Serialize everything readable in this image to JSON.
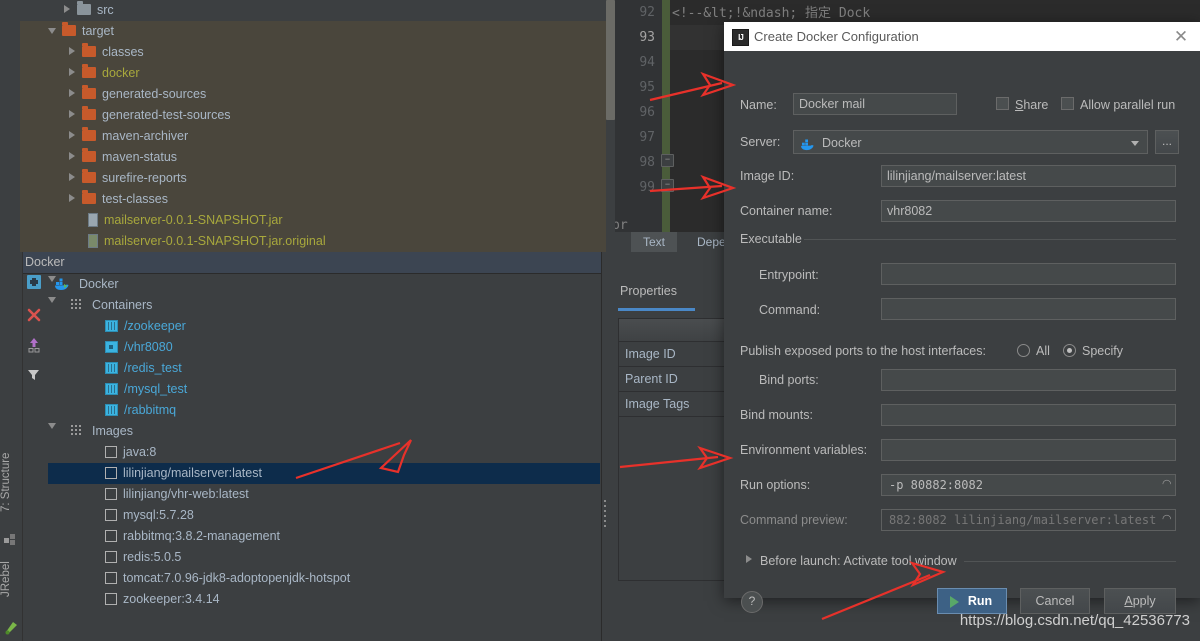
{
  "editor": {
    "code_line": "<!--&lt;!&ndash; 指定 Dock",
    "line_numbers": [
      "92",
      "93",
      "94",
      "95",
      "96",
      "97",
      "98",
      "99"
    ],
    "current_line": "93",
    "pre_text": "pr",
    "tabs": [
      {
        "label": "Text",
        "selected": true
      },
      {
        "label": "Depen",
        "selected": false
      }
    ]
  },
  "project_tree": [
    {
      "label": "src",
      "indent": 43,
      "arrow": "right",
      "icon": "folder-grey",
      "color": "normal"
    },
    {
      "label": "target",
      "indent": 28,
      "arrow": "down",
      "icon": "folder-orange",
      "color": "normal"
    },
    {
      "label": "classes",
      "indent": 48,
      "arrow": "right",
      "icon": "folder-orange",
      "color": "normal"
    },
    {
      "label": "docker",
      "indent": 48,
      "arrow": "right",
      "icon": "folder-orange",
      "color": "green"
    },
    {
      "label": "generated-sources",
      "indent": 48,
      "arrow": "right",
      "icon": "folder-orange",
      "color": "normal"
    },
    {
      "label": "generated-test-sources",
      "indent": 48,
      "arrow": "right",
      "icon": "folder-orange",
      "color": "normal"
    },
    {
      "label": "maven-archiver",
      "indent": 48,
      "arrow": "right",
      "icon": "folder-orange",
      "color": "normal"
    },
    {
      "label": "maven-status",
      "indent": 48,
      "arrow": "right",
      "icon": "folder-orange",
      "color": "normal"
    },
    {
      "label": "surefire-reports",
      "indent": 48,
      "arrow": "right",
      "icon": "folder-orange",
      "color": "normal"
    },
    {
      "label": "test-classes",
      "indent": 48,
      "arrow": "right",
      "icon": "folder-orange",
      "color": "normal"
    },
    {
      "label": "mailserver-0.0.1-SNAPSHOT.jar",
      "indent": 68,
      "arrow": "none",
      "icon": "jar",
      "color": "green"
    },
    {
      "label": "mailserver-0.0.1-SNAPSHOT.jar.original",
      "indent": 68,
      "arrow": "none",
      "icon": "jar-q",
      "color": "green"
    }
  ],
  "docker_window": {
    "title": "Docker",
    "toolbar_icons": [
      "add-icon",
      "remove-icon",
      "deploy-icon",
      "filter-icon"
    ],
    "tree": [
      {
        "label": "Docker",
        "indent": 12,
        "arrow": "down",
        "icon": "docker-icon",
        "color": "normal",
        "selected": false
      },
      {
        "label": "Containers",
        "indent": 28,
        "arrow": "down",
        "icon": "grid-icon",
        "color": "normal",
        "selected": false
      },
      {
        "label": "/zookeeper",
        "indent": 57,
        "arrow": "none",
        "icon": "container-icon",
        "color": "blue",
        "selected": false
      },
      {
        "label": "/vhr8080",
        "indent": 57,
        "arrow": "none",
        "icon": "container-running-icon",
        "color": "blue",
        "selected": false
      },
      {
        "label": "/redis_test",
        "indent": 57,
        "arrow": "none",
        "icon": "container-icon",
        "color": "blue",
        "selected": false
      },
      {
        "label": "/mysql_test",
        "indent": 57,
        "arrow": "none",
        "icon": "container-icon",
        "color": "blue",
        "selected": false
      },
      {
        "label": "/rabbitmq",
        "indent": 57,
        "arrow": "none",
        "icon": "container-icon",
        "color": "blue",
        "selected": false
      },
      {
        "label": "Images",
        "indent": 28,
        "arrow": "down",
        "icon": "grid-icon",
        "color": "normal",
        "selected": false
      },
      {
        "label": "java:8",
        "indent": 57,
        "arrow": "none",
        "icon": "image-icon",
        "color": "normal",
        "selected": false
      },
      {
        "label": "lilinjiang/mailserver:latest",
        "indent": 57,
        "arrow": "none",
        "icon": "image-icon",
        "color": "normal",
        "selected": true
      },
      {
        "label": "lilinjiang/vhr-web:latest",
        "indent": 57,
        "arrow": "none",
        "icon": "image-icon",
        "color": "normal",
        "selected": false
      },
      {
        "label": "mysql:5.7.28",
        "indent": 57,
        "arrow": "none",
        "icon": "image-icon",
        "color": "normal",
        "selected": false
      },
      {
        "label": "rabbitmq:3.8.2-management",
        "indent": 57,
        "arrow": "none",
        "icon": "image-icon",
        "color": "normal",
        "selected": false
      },
      {
        "label": "redis:5.0.5",
        "indent": 57,
        "arrow": "none",
        "icon": "image-icon",
        "color": "normal",
        "selected": false
      },
      {
        "label": "tomcat:7.0.96-jdk8-adoptopenjdk-hotspot",
        "indent": 57,
        "arrow": "none",
        "icon": "image-icon",
        "color": "normal",
        "selected": false
      },
      {
        "label": "zookeeper:3.4.14",
        "indent": 57,
        "arrow": "none",
        "icon": "image-icon",
        "color": "normal",
        "selected": false
      }
    ]
  },
  "left_sidebar": {
    "tabs": [
      "7: Structure",
      "JRebel"
    ]
  },
  "properties_panel": {
    "tab_label": "Properties",
    "rows": [
      "Image ID",
      "Parent ID",
      "Image Tags"
    ]
  },
  "dialog": {
    "title": "Create Docker Configuration",
    "close_label": "✕",
    "name_label": "Name:",
    "name_value": "Docker mail",
    "share_label": "Share",
    "share_underline": "S",
    "parallel_label": "Allow parallel run",
    "server_label": "Server:",
    "server_value": "Docker",
    "server_browse_label": "...",
    "image_id_label": "Image ID:",
    "image_id_value": "lilinjiang/mailserver:latest",
    "container_name_label": "Container name:",
    "container_name_value": "vhr8082",
    "executable_section": "Executable",
    "entrypoint_label": "Entrypoint:",
    "entrypoint_value": "",
    "command_label": "Command:",
    "command_value": "",
    "publish_label": "Publish exposed ports to the host interfaces:",
    "radio_all": "All",
    "radio_specify": "Specify",
    "radio_selected": "Specify",
    "bind_ports_label": "Bind ports:",
    "bind_ports_value": "",
    "bind_mounts_label": "Bind mounts:",
    "bind_mounts_value": "",
    "env_vars_label": "Environment variables:",
    "env_vars_value": "",
    "run_options_label": "Run options:",
    "run_options_value": "-p 80882:8082",
    "command_preview_label": "Command preview:",
    "command_preview_value": "882:8082 lilinjiang/mailserver:latest",
    "before_launch_label": "Before launch: Activate tool window",
    "help_label": "?",
    "run_label": "Run",
    "cancel_label": "Cancel",
    "apply_label": "Apply",
    "apply_underline": "A"
  },
  "watermark": "https://blog.csdn.net/qq_42536773",
  "colors": {
    "accent_blue": "#4a88c7",
    "selection": "#0d2c4b",
    "run_button": "#3d6185",
    "annotation_red": "#e03030",
    "folder_orange": "#c75a2b",
    "container_blue": "#3bb3e0",
    "excluded_bg": "#4a463c"
  }
}
